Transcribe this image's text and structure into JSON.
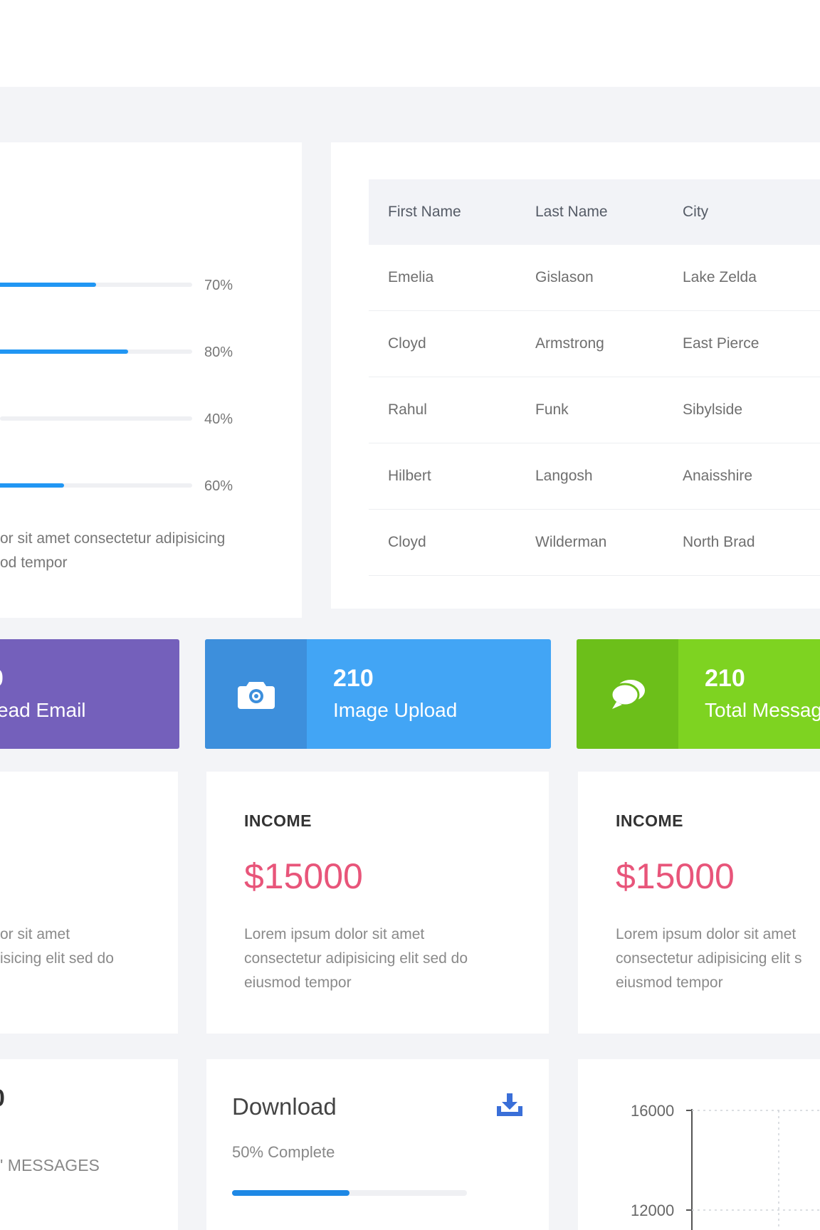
{
  "progress_card": {
    "bars": [
      {
        "value": 70,
        "label": "70%"
      },
      {
        "value": 80,
        "label": "80%"
      },
      {
        "value": 40,
        "label": "40%"
      },
      {
        "value": 60,
        "label": "60%"
      }
    ],
    "text_line1": "or sit amet consectetur adipisicing",
    "text_line2": "od tempor"
  },
  "table": {
    "headers": [
      "First Name",
      "Last Name",
      "City"
    ],
    "rows": [
      [
        "Emelia",
        "Gislason",
        "Lake Zelda"
      ],
      [
        "Cloyd",
        "Armstrong",
        "East Pierce"
      ],
      [
        "Rahul",
        "Funk",
        "Sibylside"
      ],
      [
        "Hilbert",
        "Langosh",
        "Anaisshire"
      ],
      [
        "Cloyd",
        "Wilderman",
        "North Brad"
      ]
    ]
  },
  "stats": [
    {
      "number": "0",
      "label": "ead Email",
      "icon": "mail-icon",
      "color": "#7460bb"
    },
    {
      "number": "210",
      "label": "Image Upload",
      "icon": "camera-icon",
      "color": "#42a5f5"
    },
    {
      "number": "210",
      "label": "Total Messag",
      "icon": "chat-icon",
      "color": "#7ed321"
    }
  ],
  "income_cards": [
    {
      "text_line1": "or sit amet",
      "text_line2": "isicing elit sed do"
    },
    {
      "title": "INCOME",
      "amount": "$15000",
      "text_line1": "Lorem ipsum dolor sit amet",
      "text_line2": "consectetur adipisicing elit sed do",
      "text_line3": "eiusmod tempor"
    },
    {
      "title": "INCOME",
      "amount": "$15000",
      "text_line1": "Lorem ipsum dolor sit amet",
      "text_line2": "consectetur adipisicing elit s",
      "text_line3": "eiusmod tempor"
    }
  ],
  "messages_card": {
    "number": "0",
    "label": "' MESSAGES"
  },
  "download_card": {
    "title": "Download",
    "subtitle": "50% Complete",
    "progress": 50,
    "icon": "download-icon"
  },
  "mini_chart": {
    "y_ticks": [
      "16000",
      "12000"
    ]
  }
}
